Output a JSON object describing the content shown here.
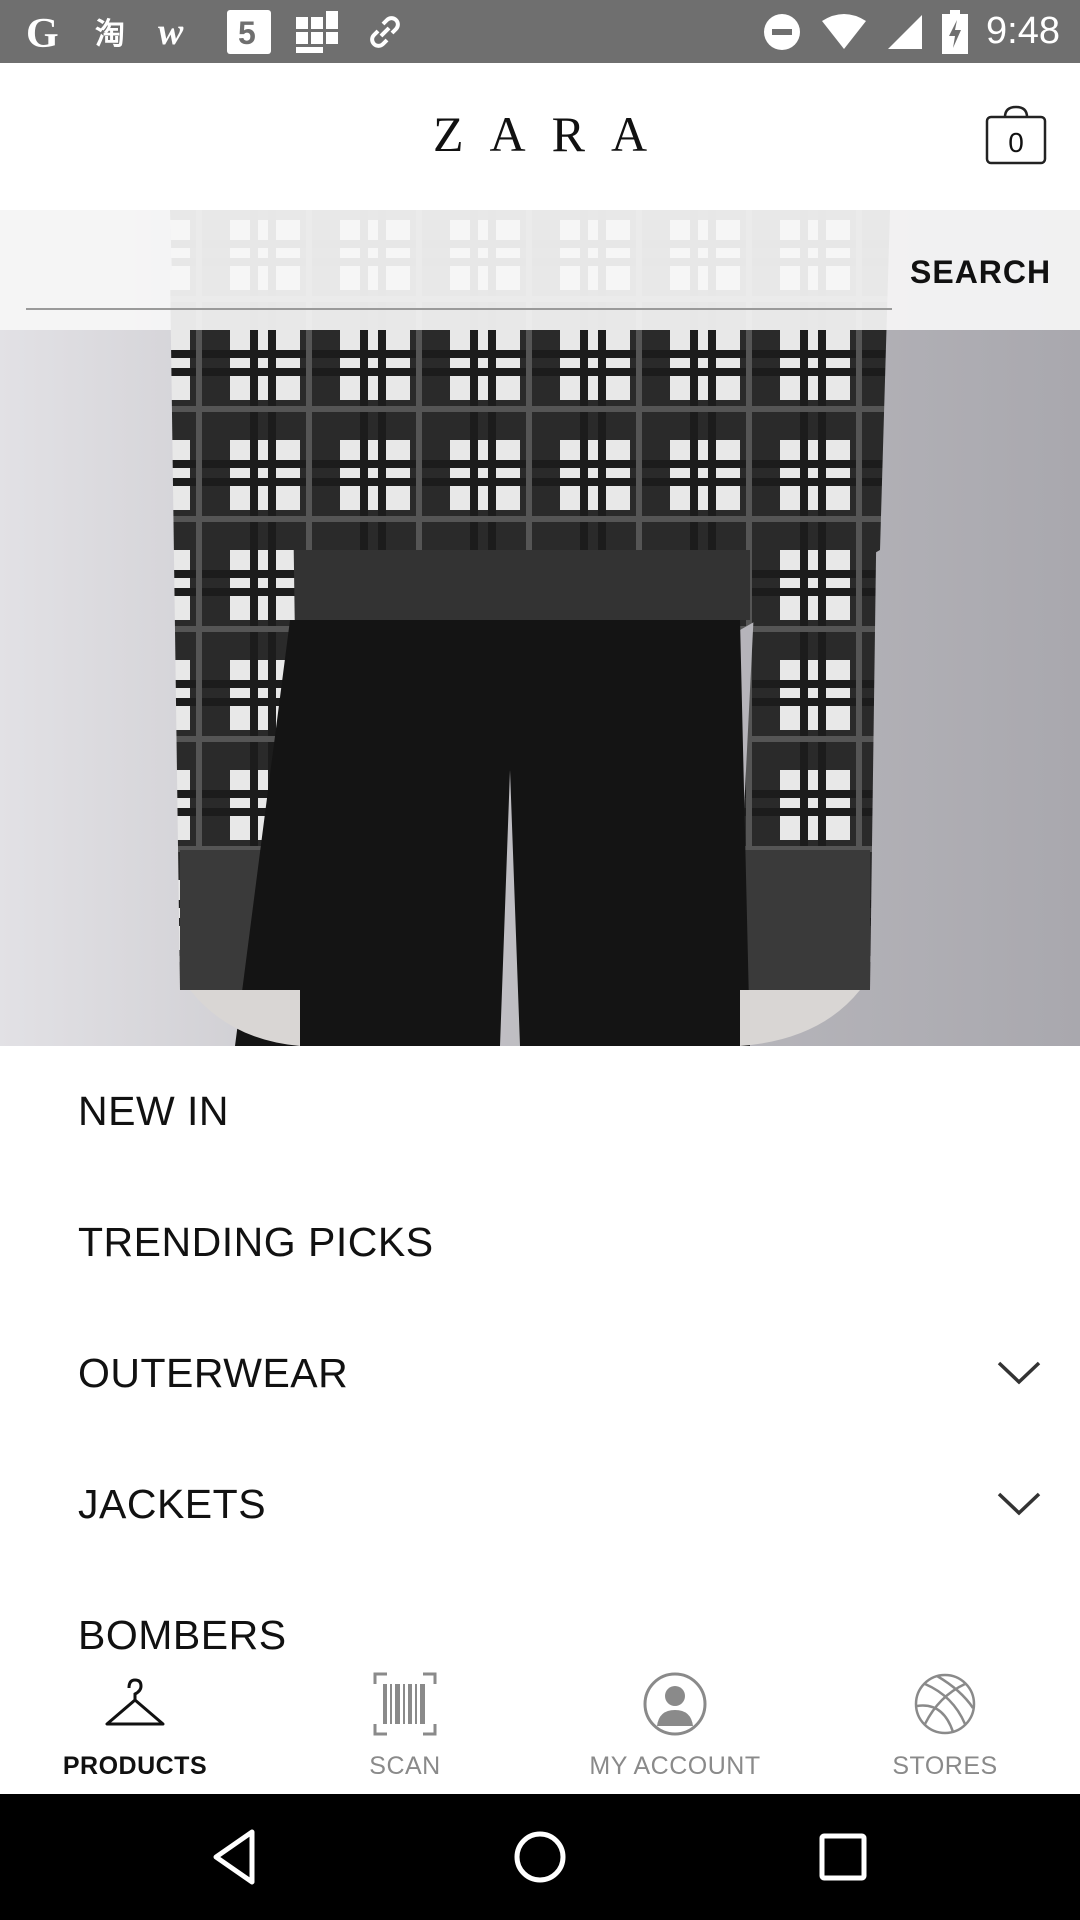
{
  "status_bar": {
    "time": "9:48",
    "left_icons": [
      "google-icon",
      "taobao-icon",
      "w-app-icon",
      "html5-icon",
      "grid-app-icon",
      "link-icon"
    ],
    "right_icons": [
      "do-not-disturb-icon",
      "wifi-icon",
      "signal-icon",
      "battery-charging-icon"
    ]
  },
  "header": {
    "logo": "ZARA",
    "bag_count": "0"
  },
  "search": {
    "value": "",
    "placeholder": "",
    "button_label": "SEARCH"
  },
  "menu": {
    "items": [
      {
        "label": "NEW IN",
        "expandable": false
      },
      {
        "label": "TRENDING PICKS",
        "expandable": false
      },
      {
        "label": "OUTERWEAR",
        "expandable": true
      },
      {
        "label": "JACKETS",
        "expandable": true
      },
      {
        "label": "BOMBERS",
        "expandable": false
      }
    ]
  },
  "bottom_nav": {
    "items": [
      {
        "label": "PRODUCTS",
        "icon": "hanger-icon",
        "active": true
      },
      {
        "label": "SCAN",
        "icon": "barcode-icon",
        "active": false
      },
      {
        "label": "MY ACCOUNT",
        "icon": "account-icon",
        "active": false
      },
      {
        "label": "STORES",
        "icon": "globe-icon",
        "active": false
      }
    ]
  },
  "colors": {
    "status_bar": "#6f6f6f",
    "active_nav": "#111111",
    "inactive_nav": "#8a8a8a",
    "system_nav": "#000000"
  }
}
